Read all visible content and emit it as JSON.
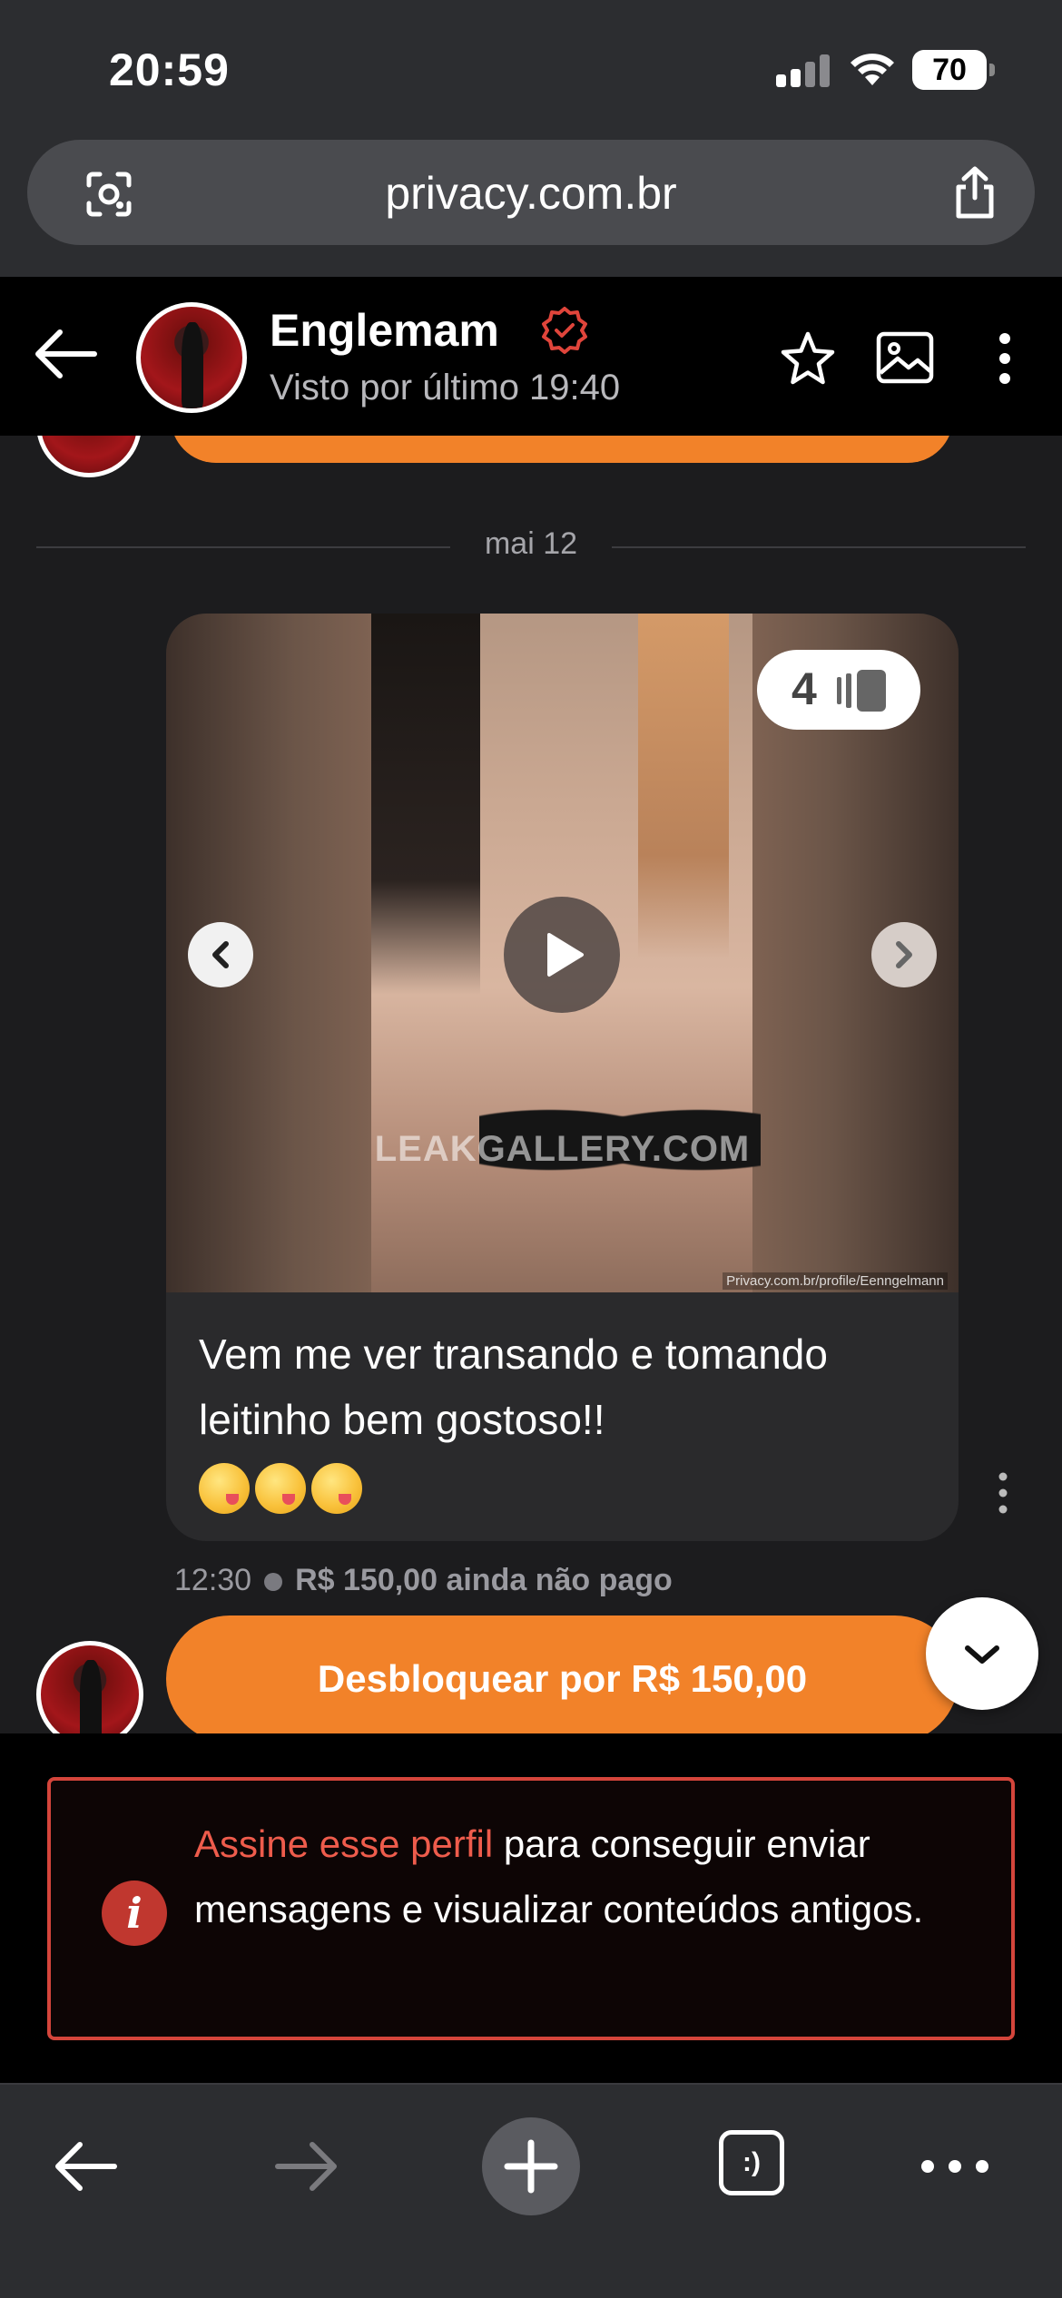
{
  "status_bar": {
    "time": "20:59",
    "battery": "70"
  },
  "browser": {
    "url": "privacy.com.br",
    "tabs_count": ":)"
  },
  "chat_header": {
    "name": "Englemam",
    "last_seen": "Visto por último 19:40"
  },
  "chat": {
    "date_divider": "mai 12",
    "media": {
      "slide_count": "4",
      "watermark": "LEAKGALLERY.COM",
      "source_label": "Privacy.com.br/profile/Eenngelmann"
    },
    "caption": "Vem me ver transando e tomando leitinho bem gostoso!!",
    "message_time": "12:30",
    "payment_status": "R$ 150,00 ainda não pago",
    "unlock_label": "Desbloquear por R$ 150,00"
  },
  "notice": {
    "link_text": "Assine esse perfil",
    "body_text": " para conseguir enviar mensagens e visualizar conteúdos antigos."
  },
  "colors": {
    "accent_orange": "#f28229",
    "alert_red": "#d4453b",
    "link_red": "#ee5c4c"
  }
}
